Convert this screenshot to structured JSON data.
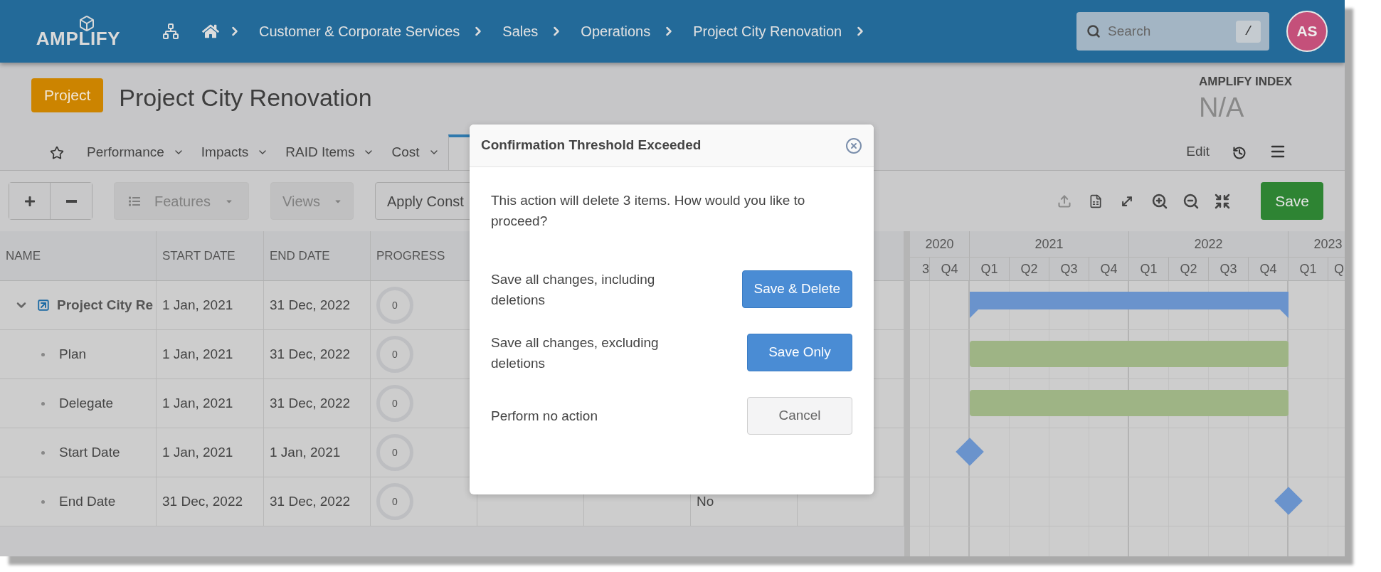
{
  "topbar": {
    "logo": "AMPLIFY",
    "breadcrumbs": [
      "Customer & Corporate Services",
      "Sales",
      "Operations",
      "Project City Renovation"
    ],
    "search": {
      "placeholder": "Search",
      "shortcut": "/"
    },
    "avatar": "AS"
  },
  "header": {
    "badge": "Project",
    "title": "Project City Renovation",
    "index_label": "AMPLIFY INDEX",
    "index_value": "N/A"
  },
  "tabs": [
    {
      "label": "Performance",
      "selected": false
    },
    {
      "label": "Impacts",
      "selected": false
    },
    {
      "label": "RAID Items",
      "selected": false
    },
    {
      "label": "Cost",
      "selected": false
    },
    {
      "selected": true
    }
  ],
  "tab_actions": {
    "edit": "Edit"
  },
  "toolbar": {
    "features": "Features",
    "views": "Views",
    "apply": "Apply Const",
    "save": "Save",
    "upload_disabled": true
  },
  "table": {
    "columns": [
      "NAME",
      "START DATE",
      "END DATE",
      "PROGRESS"
    ],
    "rows": [
      {
        "name": "Project City Re",
        "kind": "summary",
        "start": "1 Jan, 2021",
        "end": "31 Dec, 2022",
        "progress": "0"
      },
      {
        "name": "Plan",
        "kind": "task",
        "start": "1 Jan, 2021",
        "end": "31 Dec, 2022",
        "progress": "0"
      },
      {
        "name": "Delegate",
        "kind": "task",
        "start": "1 Jan, 2021",
        "end": "31 Dec, 2022",
        "progress": "0"
      },
      {
        "name": "Start Date",
        "kind": "task",
        "start": "1 Jan, 2021",
        "end": "1 Jan, 2021",
        "progress": "0"
      },
      {
        "name": "End Date",
        "kind": "task",
        "start": "31 Dec, 2022",
        "end": "31 Dec, 2022",
        "progress": "0",
        "column_7": "No"
      }
    ]
  },
  "gantt": {
    "timeline": [
      {
        "year": "2020",
        "quarters": [
          "3",
          "Q4"
        ]
      },
      {
        "year": "2021",
        "quarters": [
          "Q1",
          "Q2",
          "Q3",
          "Q4"
        ]
      },
      {
        "year": "2022",
        "quarters": [
          "Q1",
          "Q2",
          "Q3",
          "Q4"
        ]
      },
      {
        "year": "2023",
        "quarters": [
          "Q1",
          "Q"
        ]
      }
    ],
    "bars": [
      {
        "kind": "summary"
      },
      {
        "kind": "task"
      },
      {
        "kind": "task"
      },
      {
        "kind": "startmilestone"
      },
      {
        "kind": "endmilestone"
      }
    ]
  },
  "dialog": {
    "title": "Confirmation Threshold Exceeded",
    "message": "This action will delete 3 items. How would you like to proceed?",
    "options": [
      {
        "text": "Save all changes, including deletions",
        "button": "Save & Delete",
        "kind": "primary"
      },
      {
        "text": "Save all changes, excluding deletions",
        "button": "Save Only",
        "kind": "primary"
      },
      {
        "text": "Perform no action",
        "button": "Cancel",
        "kind": "default"
      }
    ]
  }
}
